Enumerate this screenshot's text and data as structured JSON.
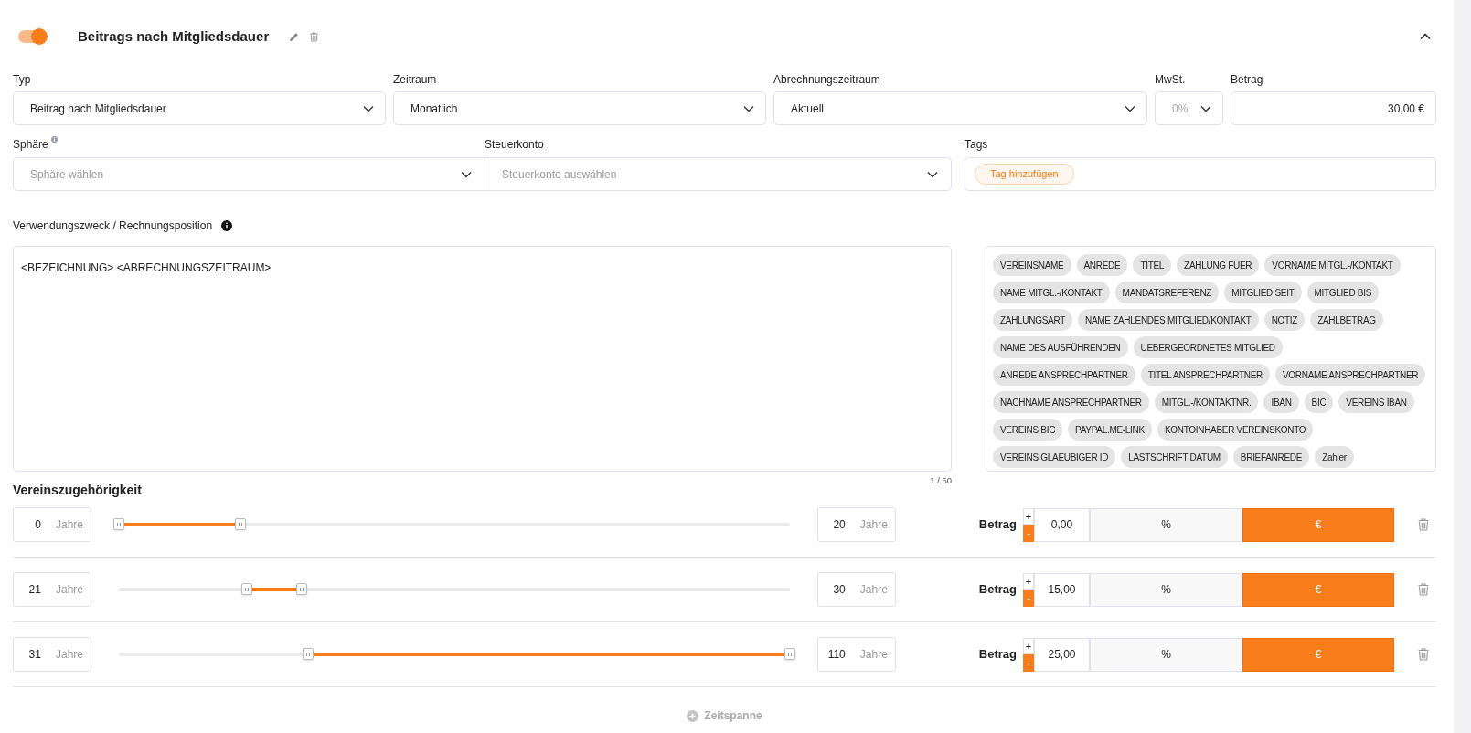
{
  "header": {
    "enabled": true,
    "title": "Beitrags nach Mitgliedsdauer",
    "expanded": true
  },
  "fields_row_1": [
    {
      "kind": "select",
      "label": "Typ",
      "value": "Beitrag nach Mitgliedsdauer",
      "disabled": false
    },
    {
      "kind": "select",
      "label": "Zeitraum",
      "value": "Monatlich",
      "disabled": false
    },
    {
      "kind": "select",
      "label": "Abrechnungszeitraum",
      "value": "Aktuell",
      "disabled": false
    },
    {
      "kind": "select",
      "label": "MwSt.",
      "value": "0%",
      "disabled": true
    },
    {
      "kind": "input",
      "label": "Betrag",
      "value": "30,00 €",
      "disabled": false
    }
  ],
  "fields_row_2": {
    "sphere": {
      "label": "Sphäre",
      "has_info": true,
      "placeholder": "Sphäre wählen"
    },
    "account": {
      "label": "Steuerkonto",
      "placeholder": "Steuerkonto auswählen"
    },
    "tags": {
      "label": "Tags",
      "add_button": "Tag hinzufügen"
    }
  },
  "purpose": {
    "label": "Verwendungszweck / Rechnungsposition",
    "value": "<BEZEICHNUNG> <ABRECHNUNGSZEITRAUM>",
    "counter": "1 / 50",
    "placeholders": [
      "VEREINSNAME",
      "ANREDE",
      "TITEL",
      "ZAHLUNG FUER",
      "VORNAME MITGL.-/KONTAKT",
      "NAME MITGL.-/KONTAKT",
      "MANDATSREFERENZ",
      "MITGLIED SEIT",
      "MITGLIED BIS",
      "ZAHLUNGSART",
      "NAME ZAHLENDES MITGLIED/KONTAKT",
      "NOTIZ",
      "ZAHLBETRAG",
      "NAME DES AUSFÜHRENDEN",
      "UEBERGEORDNETES MITGLIED",
      "ANREDE ANSPRECHPARTNER",
      "TITEL ANSPRECHPARTNER",
      "VORNAME ANSPRECHPARTNER",
      "NACHNAME ANSPRECHPARTNER",
      "MITGL.-/KONTAKTNR.",
      "IBAN",
      "BIC",
      "VEREINS IBAN",
      "VEREINS BIC",
      "PAYPAL.ME-LINK",
      "KONTOINHABER VEREINSKONTO",
      "VEREINS GLAEUBIGER ID",
      "LASTSCHRIFT DATUM",
      "BRIEFANREDE",
      "Zahler"
    ]
  },
  "membership": {
    "title": "Vereinszugehörigkeit",
    "periods": [
      {
        "from": "0",
        "from_unit": "Jahre",
        "start": {
          "level": 0
        },
        "end": {
          "level": 0.1818
        },
        "to": "20",
        "to_unit": "Jahre",
        "amount_label": "Betrag",
        "plus": "+",
        "minus": "-",
        "amount": "0,00",
        "units": [
          {
            "label": "%",
            "selected": false
          },
          {
            "label": "€",
            "selected": true
          }
        ]
      },
      {
        "from": "21",
        "from_unit": "Jahre",
        "start": {
          "level": 0.1909
        },
        "end": {
          "level": 0.2727
        },
        "to": "30",
        "to_unit": "Jahre",
        "amount_label": "Betrag",
        "plus": "+",
        "minus": "-",
        "amount": "15,00",
        "units": [
          {
            "label": "%",
            "selected": false
          },
          {
            "label": "€",
            "selected": true
          }
        ]
      },
      {
        "from": "31",
        "from_unit": "Jahre",
        "start": {
          "level": 0.2818
        },
        "end": {
          "level": 1
        },
        "to": "110",
        "to_unit": "Jahre",
        "amount_label": "Betrag",
        "plus": "+",
        "minus": "-",
        "amount": "25,00",
        "units": [
          {
            "label": "%",
            "selected": false
          },
          {
            "label": "€",
            "selected": true
          }
        ]
      }
    ],
    "add_button": "Zeitspanne"
  }
}
